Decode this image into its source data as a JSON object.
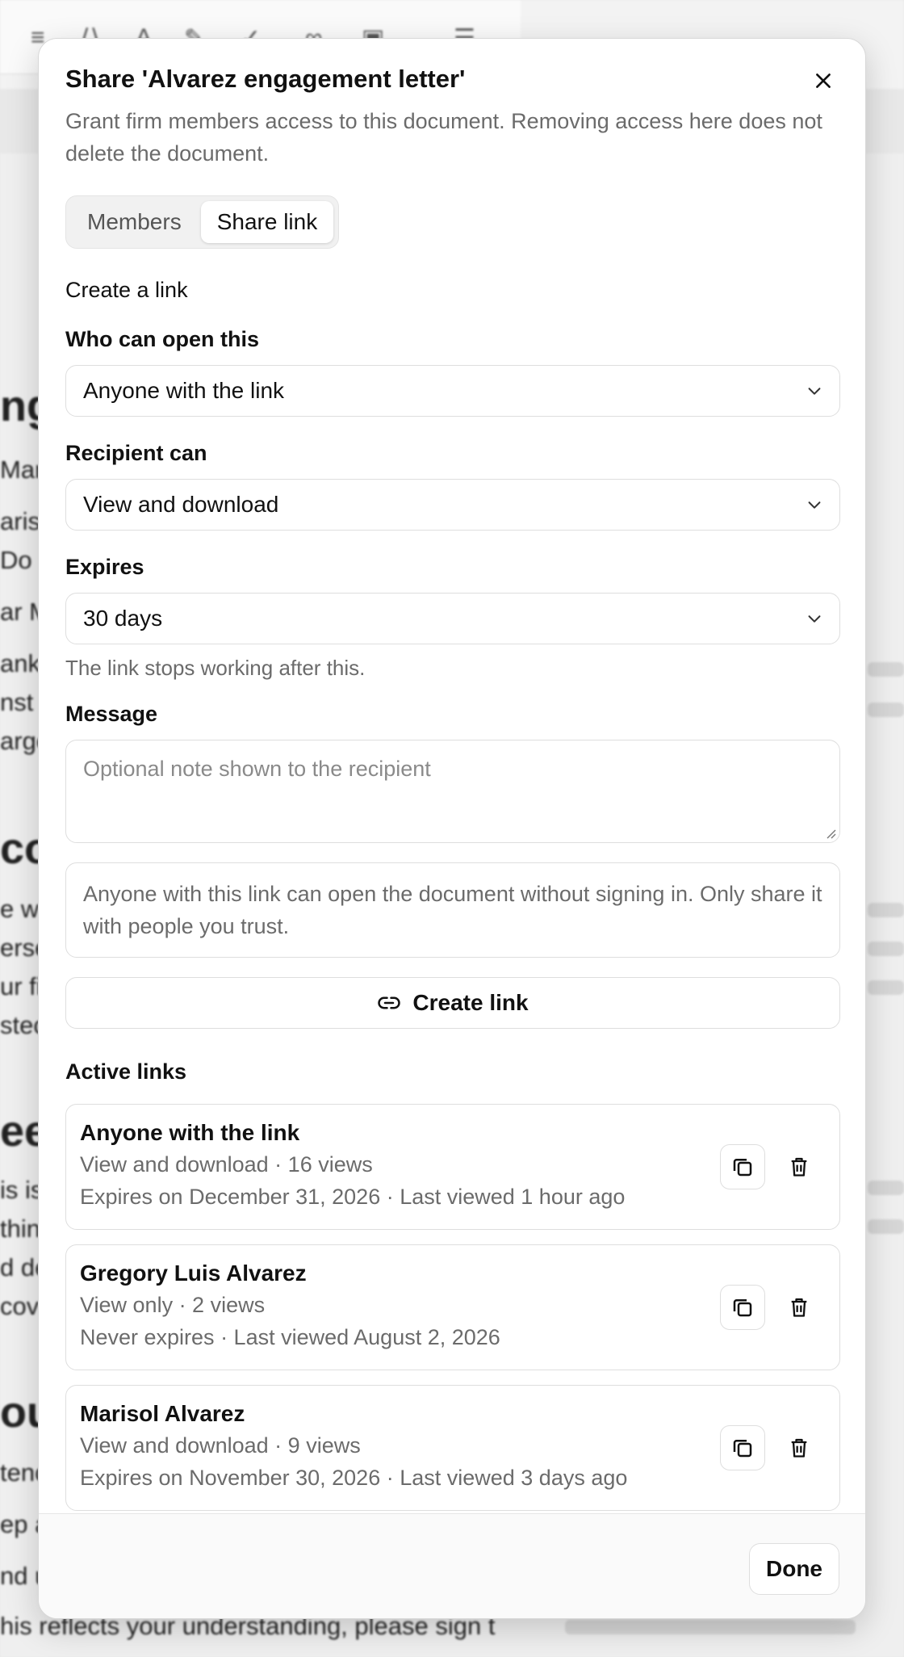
{
  "background": {
    "headings": [
      "ng",
      "co",
      "ees",
      "oul"
    ],
    "fragments": [
      "Mar",
      "ariso",
      " Do",
      "ar M",
      "ank",
      "nst",
      "arge",
      "e wi",
      "erse",
      "ur fi",
      "stec",
      "is is",
      "thin",
      "d de",
      "cove",
      "tenc",
      "ep a",
      "nd u"
    ],
    "bottom_line": "his reflects your understanding, please sign t"
  },
  "dialog": {
    "title": "Share 'Alvarez engagement letter'",
    "description": "Grant firm members access to this document. Removing access here does not delete the document.",
    "close_icon": "close-icon",
    "tabs": [
      {
        "label": "Members",
        "active": false
      },
      {
        "label": "Share link",
        "active": true
      }
    ],
    "create_heading": "Create a link",
    "who_label": "Who can open this",
    "who_value": "Anyone with the link",
    "recipient_label": "Recipient can",
    "recipient_value": "View and download",
    "expires_label": "Expires",
    "expires_value": "30 days",
    "expires_hint": "The link stops working after this.",
    "message_label": "Message",
    "message_placeholder": "Optional note shown to the recipient",
    "notice": "Anyone with this link can open the document without signing in. Only share it with people you trust.",
    "create_button": "Create link",
    "active_heading": "Active links",
    "links": [
      {
        "name": "Anyone with the link",
        "line1": "View and download · 16 views",
        "line2": "Expires on December 31, 2026 · Last viewed 1 hour ago"
      },
      {
        "name": "Gregory Luis Alvarez",
        "line1": "View only · 2 views",
        "line2": "Never expires · Last viewed August 2, 2026"
      },
      {
        "name": "Marisol Alvarez",
        "line1": "View and download · 9 views",
        "line2": "Expires on November 30, 2026 · Last viewed 3 days ago"
      }
    ],
    "done_button": "Done"
  }
}
